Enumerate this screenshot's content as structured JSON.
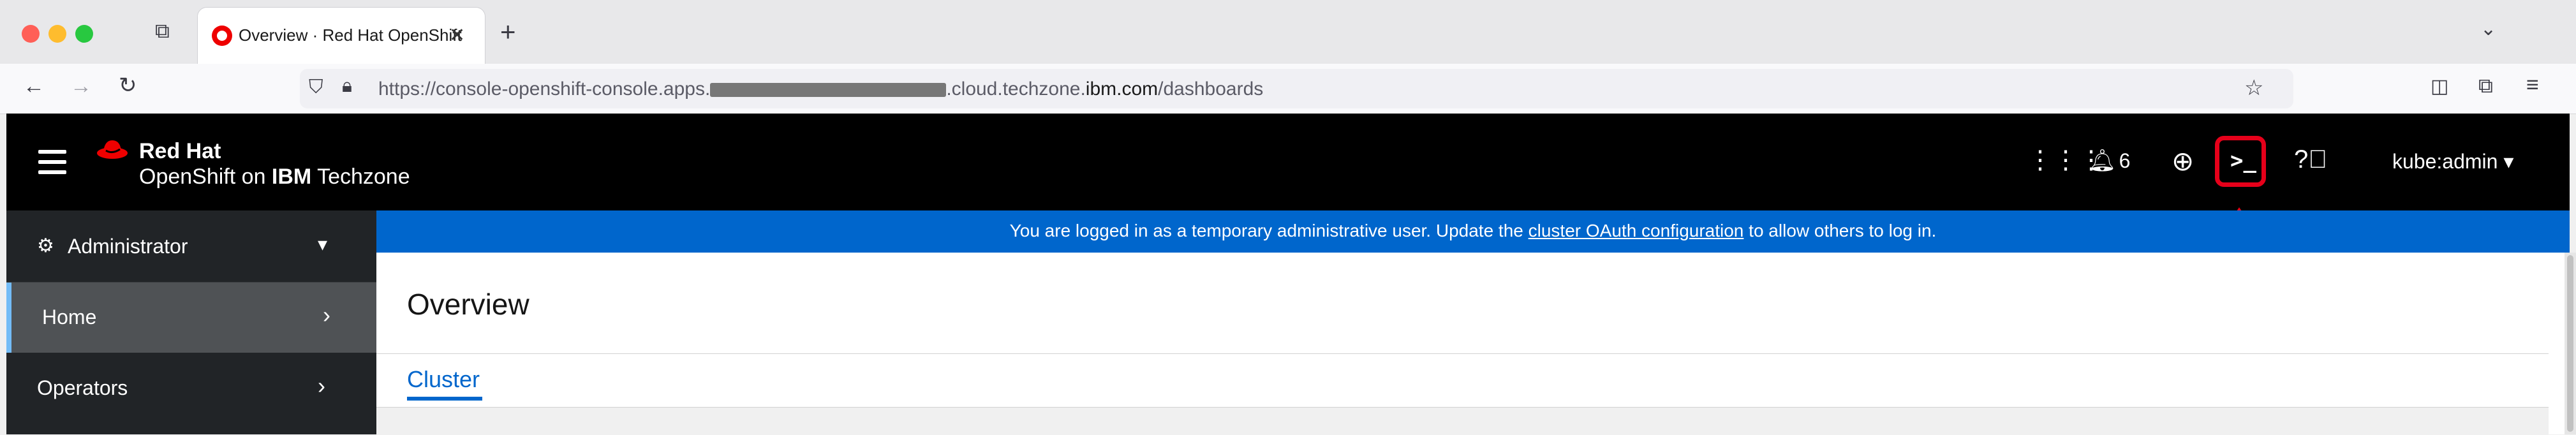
{
  "browser": {
    "tab_title": "Overview · Red Hat OpenShift",
    "tab_close": "✕",
    "new_tab": "+",
    "url_prefix": "https://console-openshift-console.apps.",
    "url_middle": ".cloud.techzone.",
    "url_domain": "ibm.com",
    "url_path": "/dashboards"
  },
  "masthead": {
    "brand_top": "Red Hat",
    "brand_sub_pre": "OpenShift on ",
    "brand_sub_bold": "IBM",
    "brand_sub_post": " Techzone",
    "notification_count": "6",
    "user": "kube:admin"
  },
  "sidebar": {
    "perspective": "Administrator",
    "items": [
      {
        "label": "Home"
      },
      {
        "label": "Operators"
      }
    ]
  },
  "banner": {
    "text_pre": "You are logged in as a temporary administrative user. Update the ",
    "link": "cluster OAuth configuration",
    "text_post": " to allow others to log in."
  },
  "main": {
    "title": "Overview",
    "tabs": [
      {
        "label": "Cluster"
      }
    ]
  },
  "colors": {
    "masthead": "#000000",
    "sidebar": "#212427",
    "banner": "#0066cc",
    "highlight": "#e6001a"
  }
}
